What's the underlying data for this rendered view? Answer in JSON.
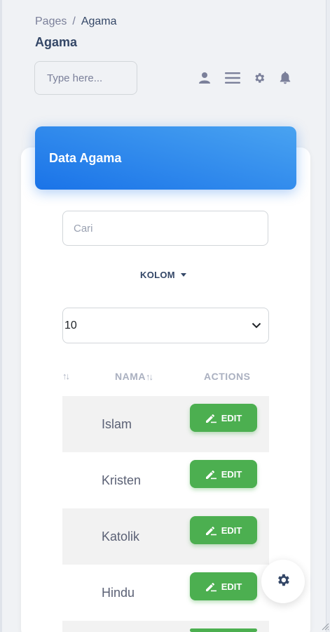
{
  "breadcrumb": {
    "root": "Pages",
    "separator": "/",
    "current": "Agama"
  },
  "page_title": "Agama",
  "navbar": {
    "search_placeholder": "Type here...",
    "icons": [
      "user-icon",
      "menu-icon",
      "gear-icon",
      "bell-icon"
    ]
  },
  "card": {
    "title": "Data Agama",
    "search_placeholder": "Cari",
    "kolom_label": "KOLOM",
    "per_page_value": "10",
    "headers": {
      "index_sort": "↑↓",
      "nama": "NAMA",
      "nama_sort": "↑↓",
      "actions": "ACTIONS"
    },
    "rows": [
      {
        "name": "Islam",
        "edit_label": "EDIT"
      },
      {
        "name": "Kristen",
        "edit_label": "EDIT"
      },
      {
        "name": "Katolik",
        "edit_label": "EDIT"
      },
      {
        "name": "Hindu",
        "edit_label": "EDIT"
      },
      {
        "name": "",
        "edit_label": ""
      }
    ]
  },
  "colors": {
    "header_gradient_start": "#49a3f1",
    "header_gradient_end": "#1a73e8",
    "edit_button": "#4caf50",
    "text_dark": "#344767"
  }
}
